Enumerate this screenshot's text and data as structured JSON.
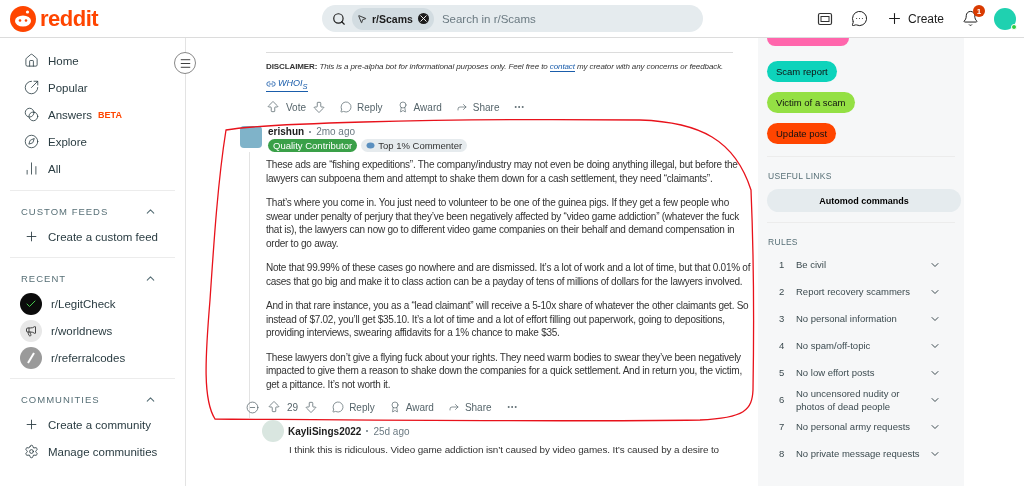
{
  "header": {
    "logo": "reddit",
    "search": {
      "chip": "r/Scams",
      "placeholder": "Search in r/Scams"
    },
    "create": "Create",
    "notifications": "1"
  },
  "nav": {
    "items": [
      {
        "label": "Home"
      },
      {
        "label": "Popular"
      },
      {
        "label": "Answers",
        "badge": "BETA"
      },
      {
        "label": "Explore"
      },
      {
        "label": "All"
      }
    ],
    "sections": [
      {
        "title": "CUSTOM FEEDS",
        "expanded": true,
        "items": [
          {
            "label": "Create a custom feed"
          }
        ]
      },
      {
        "title": "RECENT",
        "expanded": true,
        "items": [
          {
            "label": "r/LegitCheck"
          },
          {
            "label": "r/worldnews"
          },
          {
            "label": "r/referralcodes"
          }
        ]
      },
      {
        "title": "COMMUNITIES",
        "expanded": true,
        "items": [
          {
            "label": "Create a community"
          },
          {
            "label": "Manage communities"
          }
        ]
      }
    ]
  },
  "bot_comment": {
    "disclaimer_label": "DISCLAIMER:",
    "disclaimer_before": "This is a pre-alpha bot for informational purposes only. Feel free to",
    "disclaimer_link": "contact",
    "disclaimer_after": "my creator with any concerns or feedback.",
    "whois": "WHOI$_{S}$",
    "vote": "Vote",
    "actions": [
      "Reply",
      "Award",
      "Share"
    ]
  },
  "comment": {
    "author": "erishun",
    "time": "2mo ago",
    "badges": [
      {
        "label": "Quality Contributor",
        "kind": "flair"
      },
      {
        "label": "Top 1% Commenter",
        "kind": "achievement"
      }
    ],
    "paragraphs": [
      "These ads are “fishing expeditions”. The company/industry may not even be doing anything illegal, but before the lawyers can subpoena them and attempt to shake them down for a cash settlement, they need “claimants”.",
      "That’s where you come in. You just need to volunteer to be one of the guinea pigs. If they get a few people who swear under penalty of perjury that they’ve been negatively affected by “video game addiction” (whatever the fuck that is), the lawyers can now go to different video game companies on their behalf and demand compensation in order to go away.",
      "Note that 99.99% of these cases go nowhere and are dismissed. It’s a lot of work and a lot of time, but that 0.01% of cases that go big and make it to class action can be a payday of tens of millions of dollars for the lawyers involved.",
      "And in that rare instance, you as a “lead claimant” will receive a 5-10x share of whatever the other claimants get. So instead of $7.02, you’ll get $35.10. It’s a lot of time and a lot of effort filling out paperwork, going to depositions, providing interviews, swearing affidavits for a 1% chance to make $35.",
      "These lawyers don’t give a flying fuck about your rights. They need warm bodies to swear they’ve been negatively impacted to give them a reason to shake down the companies for a quick settlement. And in return you, the victim, get a pittance. It’s not worth it."
    ],
    "score": "29",
    "actions": [
      "Reply",
      "Award",
      "Share"
    ],
    "expanded": true
  },
  "reply": {
    "author": "KayliSings2022",
    "time": "25d ago",
    "text": "I think this is ridiculous. Video game addiction isn’t caused by video games. It’s caused by a desire to"
  },
  "sidebar": {
    "flairs": [
      {
        "color": "#ff66ac"
      },
      {
        "label": "Scam report",
        "color": "#0dd3bb"
      },
      {
        "label": "Victim of a scam",
        "color": "#94e044"
      },
      {
        "label": "Update post",
        "color": "#ff4500"
      }
    ],
    "useful_links": {
      "title": "USEFUL LINKS",
      "buttons": [
        "Automod commands"
      ]
    },
    "rules": {
      "title": "RULES",
      "items": [
        {
          "number": "1",
          "title": "Be civil",
          "expanded": false
        },
        {
          "number": "2",
          "title": "Report recovery scammers",
          "expanded": false
        },
        {
          "number": "3",
          "title": "No personal information",
          "expanded": false
        },
        {
          "number": "4",
          "title": "No spam/off-topic",
          "expanded": false
        },
        {
          "number": "5",
          "title": "No low effort posts",
          "expanded": false
        },
        {
          "number": "6",
          "title": "No uncensored nudity or photos of dead people",
          "expanded": false
        },
        {
          "number": "7",
          "title": "No personal army requests",
          "expanded": false
        },
        {
          "number": "8",
          "title": "No private message requests",
          "expanded": false
        }
      ]
    }
  }
}
